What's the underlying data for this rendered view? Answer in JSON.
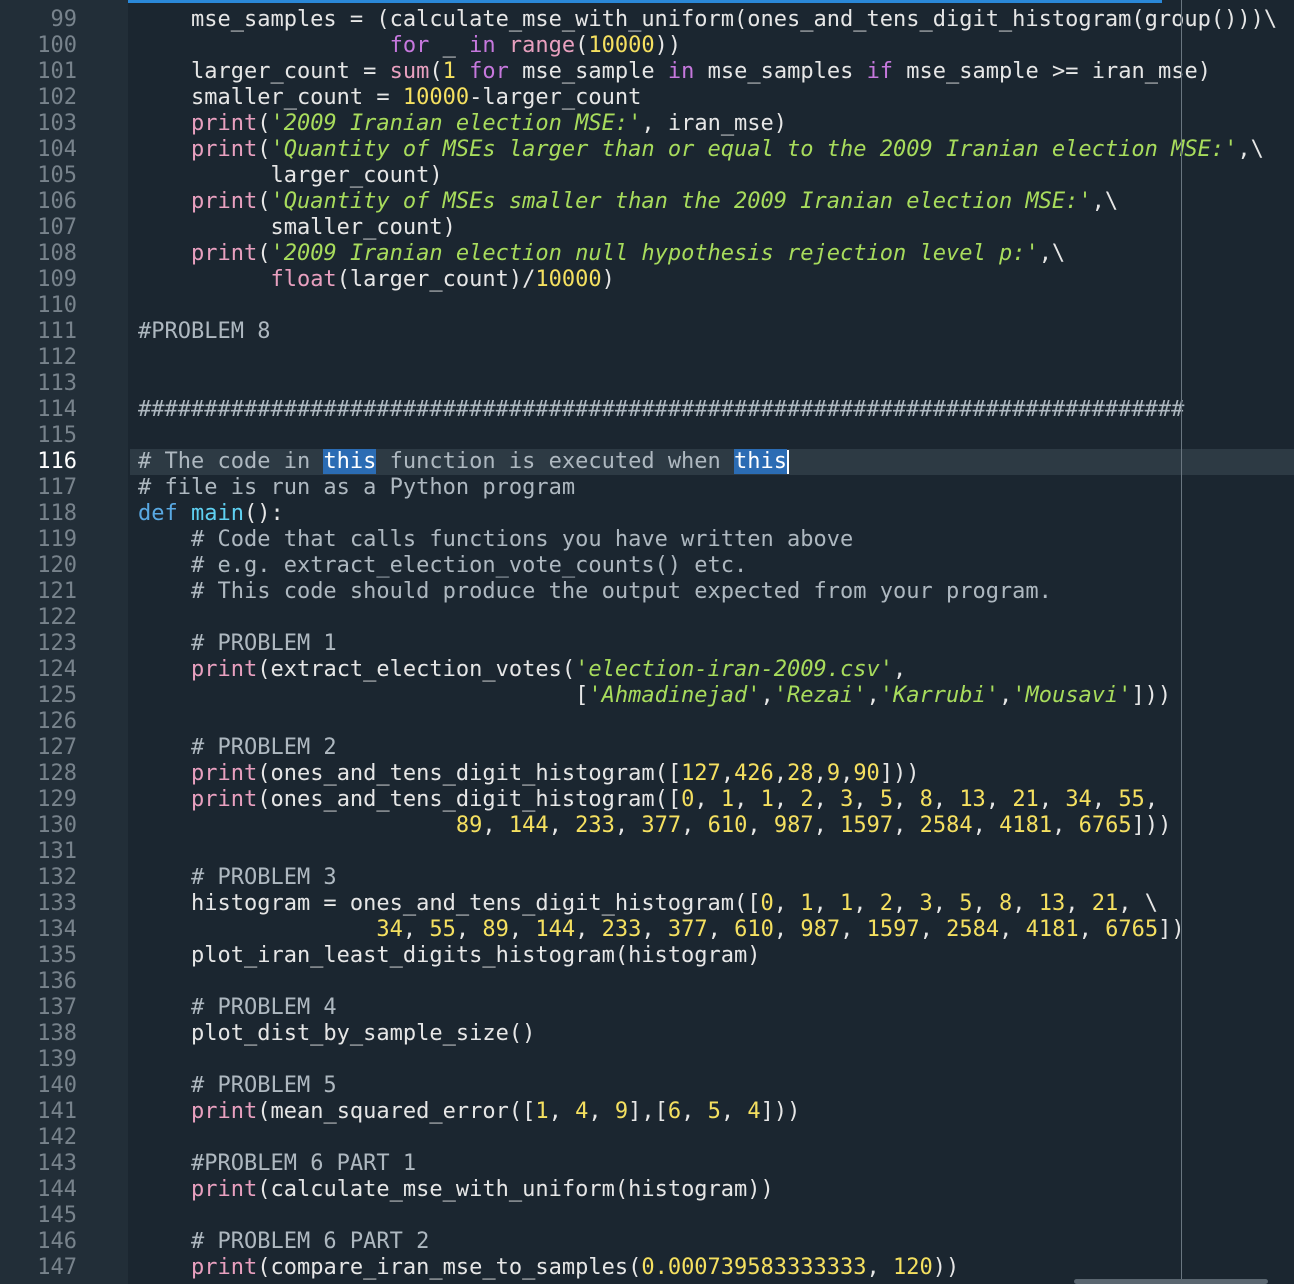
{
  "editor": {
    "current_line": 116,
    "lines": [
      {
        "n": 99,
        "tokens": [
          [
            "plain",
            "    mse_samples = (calculate_mse_with_uniform(ones_and_tens_digit_histogram(group()))\\"
          ]
        ]
      },
      {
        "n": 100,
        "tokens": [
          [
            "plain",
            "                   "
          ],
          [
            "kw",
            "for"
          ],
          [
            "plain",
            " _ "
          ],
          [
            "kw",
            "in"
          ],
          [
            "plain",
            " "
          ],
          [
            "fn",
            "range"
          ],
          [
            "plain",
            "("
          ],
          [
            "num",
            "10000"
          ],
          [
            "plain",
            "))"
          ]
        ]
      },
      {
        "n": 101,
        "tokens": [
          [
            "plain",
            "    larger_count = "
          ],
          [
            "fn",
            "sum"
          ],
          [
            "plain",
            "("
          ],
          [
            "num",
            "1"
          ],
          [
            "plain",
            " "
          ],
          [
            "kw",
            "for"
          ],
          [
            "plain",
            " mse_sample "
          ],
          [
            "kw",
            "in"
          ],
          [
            "plain",
            " mse_samples "
          ],
          [
            "kw",
            "if"
          ],
          [
            "plain",
            " mse_sample >= iran_mse)"
          ]
        ]
      },
      {
        "n": 102,
        "tokens": [
          [
            "plain",
            "    smaller_count = "
          ],
          [
            "num",
            "10000"
          ],
          [
            "plain",
            "-larger_count"
          ]
        ]
      },
      {
        "n": 103,
        "tokens": [
          [
            "plain",
            "    "
          ],
          [
            "fn",
            "print"
          ],
          [
            "plain",
            "("
          ],
          [
            "str",
            "'2009 Iranian election MSE:'"
          ],
          [
            "plain",
            ", iran_mse)"
          ]
        ]
      },
      {
        "n": 104,
        "tokens": [
          [
            "plain",
            "    "
          ],
          [
            "fn",
            "print"
          ],
          [
            "plain",
            "("
          ],
          [
            "str",
            "'Quantity of MSEs larger than or equal to the 2009 Iranian election MSE:'"
          ],
          [
            "plain",
            ",\\"
          ]
        ]
      },
      {
        "n": 105,
        "tokens": [
          [
            "plain",
            "          larger_count)"
          ]
        ]
      },
      {
        "n": 106,
        "tokens": [
          [
            "plain",
            "    "
          ],
          [
            "fn",
            "print"
          ],
          [
            "plain",
            "("
          ],
          [
            "str",
            "'Quantity of MSEs smaller than the 2009 Iranian election MSE:'"
          ],
          [
            "plain",
            ",\\"
          ]
        ]
      },
      {
        "n": 107,
        "tokens": [
          [
            "plain",
            "          smaller_count)"
          ]
        ]
      },
      {
        "n": 108,
        "tokens": [
          [
            "plain",
            "    "
          ],
          [
            "fn",
            "print"
          ],
          [
            "plain",
            "("
          ],
          [
            "str",
            "'2009 Iranian election null hypothesis rejection level p:'"
          ],
          [
            "plain",
            ",\\"
          ]
        ]
      },
      {
        "n": 109,
        "tokens": [
          [
            "plain",
            "          "
          ],
          [
            "fn",
            "float"
          ],
          [
            "plain",
            "(larger_count)/"
          ],
          [
            "num",
            "10000"
          ],
          [
            "plain",
            ")"
          ]
        ]
      },
      {
        "n": 110,
        "tokens": []
      },
      {
        "n": 111,
        "tokens": [
          [
            "cmt",
            "#PROBLEM 8"
          ]
        ]
      },
      {
        "n": 112,
        "tokens": []
      },
      {
        "n": 113,
        "tokens": []
      },
      {
        "n": 114,
        "tokens": [
          [
            "cmt",
            "###############################################################################"
          ]
        ]
      },
      {
        "n": 115,
        "tokens": []
      },
      {
        "n": 116,
        "tokens": [
          [
            "cmt",
            "# The code in "
          ],
          [
            "sel",
            "this"
          ],
          [
            "cmt",
            " function is executed when "
          ],
          [
            "sel",
            "this"
          ]
        ]
      },
      {
        "n": 117,
        "tokens": [
          [
            "cmt",
            "# file is run as a Python program"
          ]
        ]
      },
      {
        "n": 118,
        "tokens": [
          [
            "def",
            "def"
          ],
          [
            "plain",
            " "
          ],
          [
            "name",
            "main"
          ],
          [
            "plain",
            "():"
          ]
        ]
      },
      {
        "n": 119,
        "tokens": [
          [
            "plain",
            "    "
          ],
          [
            "cmt",
            "# Code that calls functions you have written above"
          ]
        ]
      },
      {
        "n": 120,
        "tokens": [
          [
            "plain",
            "    "
          ],
          [
            "cmt",
            "# e.g. extract_election_vote_counts() etc."
          ]
        ]
      },
      {
        "n": 121,
        "tokens": [
          [
            "plain",
            "    "
          ],
          [
            "cmt",
            "# This code should produce the output expected from your program."
          ]
        ]
      },
      {
        "n": 122,
        "tokens": []
      },
      {
        "n": 123,
        "tokens": [
          [
            "plain",
            "    "
          ],
          [
            "cmt",
            "# PROBLEM 1"
          ]
        ]
      },
      {
        "n": 124,
        "tokens": [
          [
            "plain",
            "    "
          ],
          [
            "fn",
            "print"
          ],
          [
            "plain",
            "(extract_election_votes("
          ],
          [
            "str",
            "'election-iran-2009.csv'"
          ],
          [
            "plain",
            ","
          ]
        ]
      },
      {
        "n": 125,
        "tokens": [
          [
            "plain",
            "                                 ["
          ],
          [
            "str",
            "'Ahmadinejad'"
          ],
          [
            "plain",
            ","
          ],
          [
            "str",
            "'Rezai'"
          ],
          [
            "plain",
            ","
          ],
          [
            "str",
            "'Karrubi'"
          ],
          [
            "plain",
            ","
          ],
          [
            "str",
            "'Mousavi'"
          ],
          [
            "plain",
            "]))"
          ]
        ]
      },
      {
        "n": 126,
        "tokens": []
      },
      {
        "n": 127,
        "tokens": [
          [
            "plain",
            "    "
          ],
          [
            "cmt",
            "# PROBLEM 2"
          ]
        ]
      },
      {
        "n": 128,
        "tokens": [
          [
            "plain",
            "    "
          ],
          [
            "fn",
            "print"
          ],
          [
            "plain",
            "(ones_and_tens_digit_histogram(["
          ],
          [
            "num",
            "127"
          ],
          [
            "plain",
            ","
          ],
          [
            "num",
            "426"
          ],
          [
            "plain",
            ","
          ],
          [
            "num",
            "28"
          ],
          [
            "plain",
            ","
          ],
          [
            "num",
            "9"
          ],
          [
            "plain",
            ","
          ],
          [
            "num",
            "90"
          ],
          [
            "plain",
            "]))"
          ]
        ]
      },
      {
        "n": 129,
        "tokens": [
          [
            "plain",
            "    "
          ],
          [
            "fn",
            "print"
          ],
          [
            "plain",
            "(ones_and_tens_digit_histogram(["
          ],
          [
            "num",
            "0"
          ],
          [
            "plain",
            ", "
          ],
          [
            "num",
            "1"
          ],
          [
            "plain",
            ", "
          ],
          [
            "num",
            "1"
          ],
          [
            "plain",
            ", "
          ],
          [
            "num",
            "2"
          ],
          [
            "plain",
            ", "
          ],
          [
            "num",
            "3"
          ],
          [
            "plain",
            ", "
          ],
          [
            "num",
            "5"
          ],
          [
            "plain",
            ", "
          ],
          [
            "num",
            "8"
          ],
          [
            "plain",
            ", "
          ],
          [
            "num",
            "13"
          ],
          [
            "plain",
            ", "
          ],
          [
            "num",
            "21"
          ],
          [
            "plain",
            ", "
          ],
          [
            "num",
            "34"
          ],
          [
            "plain",
            ", "
          ],
          [
            "num",
            "55"
          ],
          [
            "plain",
            ","
          ]
        ]
      },
      {
        "n": 130,
        "tokens": [
          [
            "plain",
            "                        "
          ],
          [
            "num",
            "89"
          ],
          [
            "plain",
            ", "
          ],
          [
            "num",
            "144"
          ],
          [
            "plain",
            ", "
          ],
          [
            "num",
            "233"
          ],
          [
            "plain",
            ", "
          ],
          [
            "num",
            "377"
          ],
          [
            "plain",
            ", "
          ],
          [
            "num",
            "610"
          ],
          [
            "plain",
            ", "
          ],
          [
            "num",
            "987"
          ],
          [
            "plain",
            ", "
          ],
          [
            "num",
            "1597"
          ],
          [
            "plain",
            ", "
          ],
          [
            "num",
            "2584"
          ],
          [
            "plain",
            ", "
          ],
          [
            "num",
            "4181"
          ],
          [
            "plain",
            ", "
          ],
          [
            "num",
            "6765"
          ],
          [
            "plain",
            "]))"
          ]
        ]
      },
      {
        "n": 131,
        "tokens": []
      },
      {
        "n": 132,
        "tokens": [
          [
            "plain",
            "    "
          ],
          [
            "cmt",
            "# PROBLEM 3"
          ]
        ]
      },
      {
        "n": 133,
        "tokens": [
          [
            "plain",
            "    histogram = ones_and_tens_digit_histogram(["
          ],
          [
            "num",
            "0"
          ],
          [
            "plain",
            ", "
          ],
          [
            "num",
            "1"
          ],
          [
            "plain",
            ", "
          ],
          [
            "num",
            "1"
          ],
          [
            "plain",
            ", "
          ],
          [
            "num",
            "2"
          ],
          [
            "plain",
            ", "
          ],
          [
            "num",
            "3"
          ],
          [
            "plain",
            ", "
          ],
          [
            "num",
            "5"
          ],
          [
            "plain",
            ", "
          ],
          [
            "num",
            "8"
          ],
          [
            "plain",
            ", "
          ],
          [
            "num",
            "13"
          ],
          [
            "plain",
            ", "
          ],
          [
            "num",
            "21"
          ],
          [
            "plain",
            ", \\"
          ]
        ]
      },
      {
        "n": 134,
        "tokens": [
          [
            "plain",
            "                  "
          ],
          [
            "num",
            "34"
          ],
          [
            "plain",
            ", "
          ],
          [
            "num",
            "55"
          ],
          [
            "plain",
            ", "
          ],
          [
            "num",
            "89"
          ],
          [
            "plain",
            ", "
          ],
          [
            "num",
            "144"
          ],
          [
            "plain",
            ", "
          ],
          [
            "num",
            "233"
          ],
          [
            "plain",
            ", "
          ],
          [
            "num",
            "377"
          ],
          [
            "plain",
            ", "
          ],
          [
            "num",
            "610"
          ],
          [
            "plain",
            ", "
          ],
          [
            "num",
            "987"
          ],
          [
            "plain",
            ", "
          ],
          [
            "num",
            "1597"
          ],
          [
            "plain",
            ", "
          ],
          [
            "num",
            "2584"
          ],
          [
            "plain",
            ", "
          ],
          [
            "num",
            "4181"
          ],
          [
            "plain",
            ", "
          ],
          [
            "num",
            "6765"
          ],
          [
            "plain",
            "])"
          ]
        ]
      },
      {
        "n": 135,
        "tokens": [
          [
            "plain",
            "    plot_iran_least_digits_histogram(histogram)"
          ]
        ]
      },
      {
        "n": 136,
        "tokens": []
      },
      {
        "n": 137,
        "tokens": [
          [
            "plain",
            "    "
          ],
          [
            "cmt",
            "# PROBLEM 4"
          ]
        ]
      },
      {
        "n": 138,
        "tokens": [
          [
            "plain",
            "    plot_dist_by_sample_size()"
          ]
        ]
      },
      {
        "n": 139,
        "tokens": []
      },
      {
        "n": 140,
        "tokens": [
          [
            "plain",
            "    "
          ],
          [
            "cmt",
            "# PROBLEM 5"
          ]
        ]
      },
      {
        "n": 141,
        "tokens": [
          [
            "plain",
            "    "
          ],
          [
            "fn",
            "print"
          ],
          [
            "plain",
            "(mean_squared_error(["
          ],
          [
            "num",
            "1"
          ],
          [
            "plain",
            ", "
          ],
          [
            "num",
            "4"
          ],
          [
            "plain",
            ", "
          ],
          [
            "num",
            "9"
          ],
          [
            "plain",
            "],["
          ],
          [
            "num",
            "6"
          ],
          [
            "plain",
            ", "
          ],
          [
            "num",
            "5"
          ],
          [
            "plain",
            ", "
          ],
          [
            "num",
            "4"
          ],
          [
            "plain",
            "]))"
          ]
        ]
      },
      {
        "n": 142,
        "tokens": []
      },
      {
        "n": 143,
        "tokens": [
          [
            "plain",
            "    "
          ],
          [
            "cmt",
            "#PROBLEM 6 PART 1"
          ]
        ]
      },
      {
        "n": 144,
        "tokens": [
          [
            "plain",
            "    "
          ],
          [
            "fn",
            "print"
          ],
          [
            "plain",
            "(calculate_mse_with_uniform(histogram))"
          ]
        ]
      },
      {
        "n": 145,
        "tokens": []
      },
      {
        "n": 146,
        "tokens": [
          [
            "plain",
            "    "
          ],
          [
            "cmt",
            "# PROBLEM 6 PART 2"
          ]
        ]
      },
      {
        "n": 147,
        "tokens": [
          [
            "plain",
            "    "
          ],
          [
            "fn",
            "print"
          ],
          [
            "plain",
            "(compare_iran_mse_to_samples("
          ],
          [
            "num",
            "0.000739583333333"
          ],
          [
            "plain",
            ", "
          ],
          [
            "num",
            "120"
          ],
          [
            "plain",
            "))"
          ]
        ]
      }
    ]
  },
  "theme": {
    "background": "#1b2630",
    "gutter": "#222e38",
    "keyword": "#c678dd",
    "builtin": "#e8a0bf",
    "number": "#f5e060",
    "string": "#a8dc5c",
    "comment": "#aeb8c0",
    "selection": "#2b6cb4"
  }
}
